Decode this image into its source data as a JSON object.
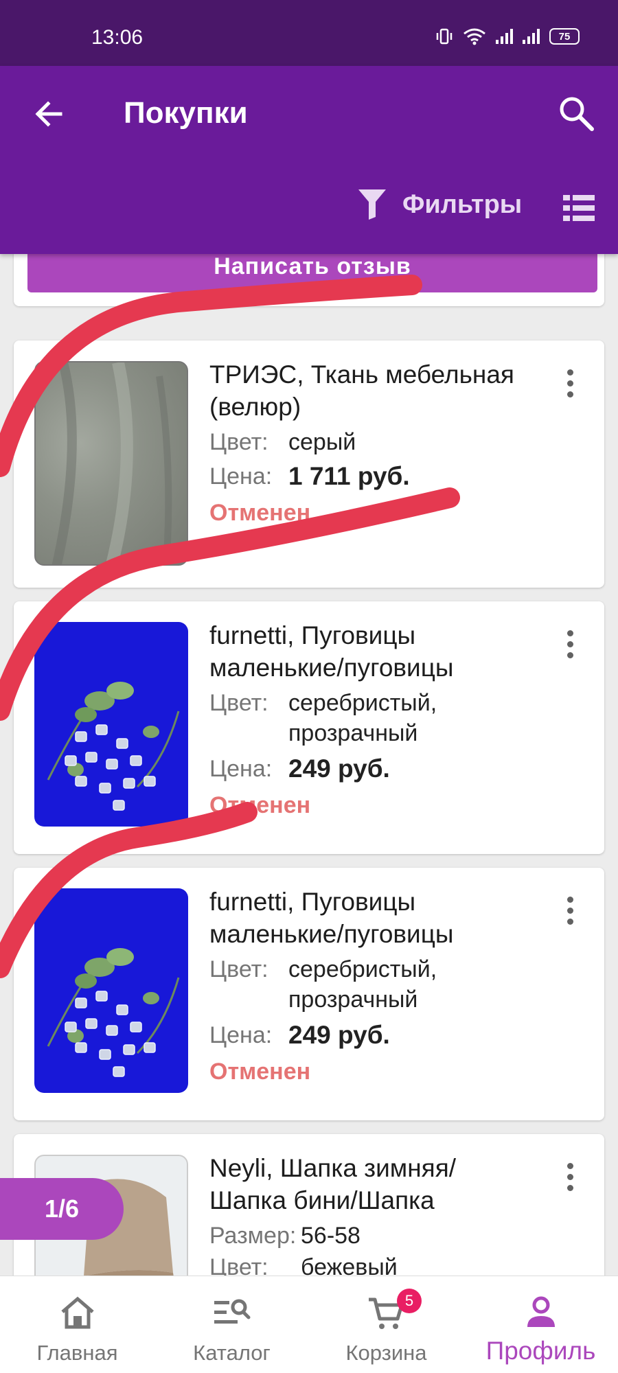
{
  "status_bar": {
    "time": "13:06",
    "battery": "75"
  },
  "app_bar": {
    "title": "Покупки",
    "filters_label": "Фильтры"
  },
  "previous_card": {
    "review_button": "Написать отзыв"
  },
  "orders": [
    {
      "title": "ТРИЭС, Ткань мебельная (велюр)",
      "specs": [
        {
          "label": "Цвет:",
          "value": "серый"
        }
      ],
      "price_label": "Цена:",
      "price": "1 711 руб.",
      "status": "Отменен"
    },
    {
      "title": "furnetti, Пуговицы маленькие/пуговицы",
      "specs": [
        {
          "label": "Цвет:",
          "value": "серебристый, прозрачный"
        }
      ],
      "price_label": "Цена:",
      "price": "249 руб.",
      "status": "Отменен"
    },
    {
      "title": "furnetti, Пуговицы маленькие/пуговицы",
      "specs": [
        {
          "label": "Цвет:",
          "value": "серебристый, прозрачный"
        }
      ],
      "price_label": "Цена:",
      "price": "249 руб.",
      "status": "Отменен"
    },
    {
      "title": "Neyli, Шапка зимняя/ Шапка бини/Шапка",
      "specs": [
        {
          "label": "Размер:",
          "value": "56-58"
        },
        {
          "label": "Цвет:",
          "value": "бежевый"
        }
      ]
    }
  ],
  "page_indicator": "1/6",
  "bottom_nav": [
    {
      "label": "Главная",
      "icon": "home-icon"
    },
    {
      "label": "Каталог",
      "icon": "catalog-search-icon"
    },
    {
      "label": "Корзина",
      "icon": "cart-icon",
      "badge": "5"
    },
    {
      "label": "Профиль",
      "icon": "profile-icon",
      "active": true
    }
  ],
  "colors": {
    "status_bar": "#4a1769",
    "app_bar": "#6a1b9a",
    "accent": "#ab47bc",
    "status_cancelled": "#e57373",
    "annotation_marker": "#e53950"
  }
}
